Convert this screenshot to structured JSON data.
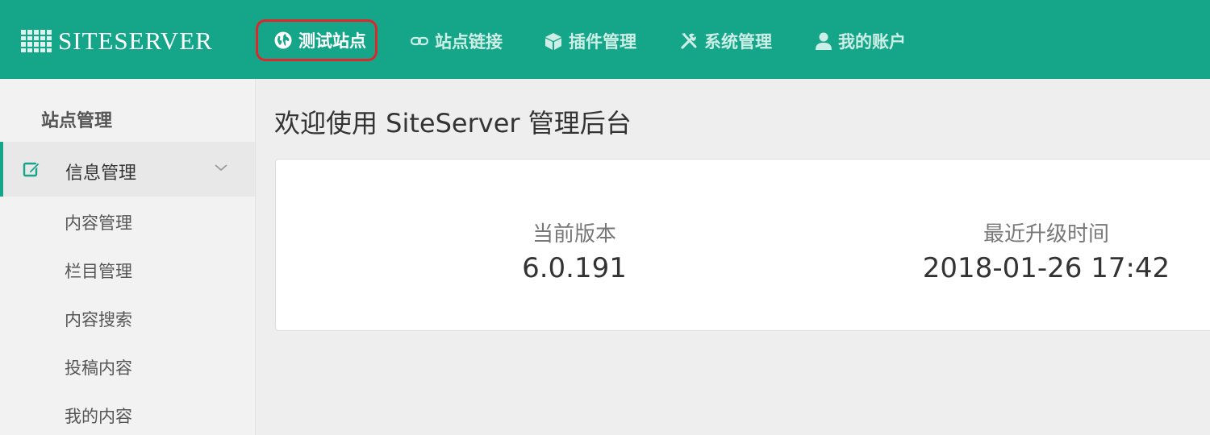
{
  "brand": {
    "logo_text": "SITESERVER"
  },
  "nav": {
    "items": [
      {
        "label": "测试站点",
        "icon": "globe-icon",
        "active": true
      },
      {
        "label": "站点链接",
        "icon": "link-icon",
        "active": false
      },
      {
        "label": "插件管理",
        "icon": "cube-icon",
        "active": false
      },
      {
        "label": "系统管理",
        "icon": "tools-icon",
        "active": false
      },
      {
        "label": "我的账户",
        "icon": "user-icon",
        "active": false
      }
    ]
  },
  "sidebar": {
    "header": "站点管理",
    "group": {
      "label": "信息管理",
      "icon": "edit-icon",
      "expanded": true
    },
    "items": [
      {
        "label": "内容管理"
      },
      {
        "label": "栏目管理"
      },
      {
        "label": "内容搜索"
      },
      {
        "label": "投稿内容"
      },
      {
        "label": "我的内容"
      }
    ]
  },
  "main": {
    "title": "欢迎使用 SiteServer 管理后台",
    "stats": {
      "version_label": "当前版本",
      "version_value": "6.0.191",
      "upgrade_label": "最近升级时间",
      "upgrade_value": "2018-01-26 17:42"
    }
  },
  "colors": {
    "accent": "#15a589",
    "highlight_border": "#e0262b"
  }
}
